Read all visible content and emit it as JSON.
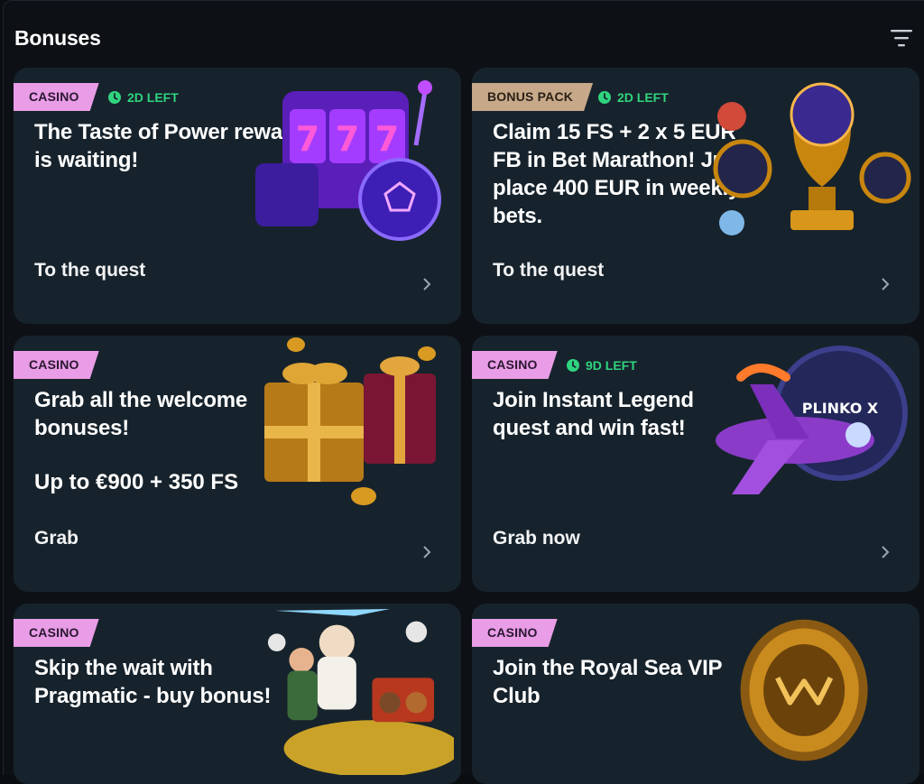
{
  "header": {
    "title": "Bonuses",
    "filter_icon": "filter-icon"
  },
  "cards": [
    {
      "tag": "CASINO",
      "timer": "2D LEFT",
      "title": "The Taste of Power reward is waiting!",
      "cta": "To the quest",
      "art": "slot-machine-ball-illustration"
    },
    {
      "tag": "BONUS PACK",
      "timer": "2D LEFT",
      "title": "Claim 15 FS + 2 x 5 EUR FB in Bet Marathon! Just place 400 EUR in weekly bets.",
      "cta": "To the quest",
      "art": "trophy-coins-illustration"
    },
    {
      "tag": "CASINO",
      "title": "Grab all the welcome bonuses!",
      "subtitle": "Up to €900 + 350 FS",
      "cta": "Grab",
      "art": "gift-boxes-illustration"
    },
    {
      "tag": "CASINO",
      "timer": "9D LEFT",
      "title": "Join Instant Legend quest and win fast!",
      "cta": "Grab now",
      "art": "plane-plinko-illustration",
      "art_text": "PLINKO X"
    },
    {
      "tag": "CASINO",
      "title": "Skip the wait with Pragmatic - buy bonus!",
      "art": "zeus-gold-illustration"
    },
    {
      "tag": "CASINO",
      "title": "Join the Royal Sea VIP Club",
      "art": "vip-coin-illustration"
    }
  ],
  "colors": {
    "tag_casino": "#e89de6",
    "tag_pack": "#c7a98a",
    "timer": "#2fd47f",
    "card_bg": "#17232c"
  }
}
